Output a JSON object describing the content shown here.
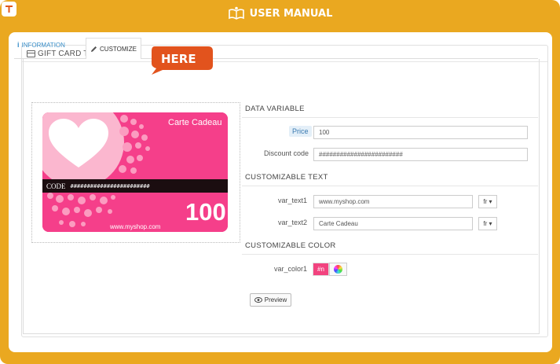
{
  "app": {
    "title": "USER MANUAL"
  },
  "panel": {
    "heading": "GIFT CARD TEMPLATE"
  },
  "tabs": [
    {
      "label": "INFORMATION",
      "active": false
    },
    {
      "label": "CUSTOMIZE",
      "active": true
    }
  ],
  "callout": {
    "text": "HERE"
  },
  "card": {
    "title": "Carte Cadeau",
    "code_label": "CODE",
    "code_value": "########################",
    "amount": "100",
    "site": "www.myshop.com"
  },
  "data_variable": {
    "heading": "DATA VARIABLE",
    "price_label": "Price",
    "price_value": "100",
    "discount_label": "Discount code",
    "discount_value": "########################"
  },
  "customizable_text": {
    "heading": "CUSTOMIZABLE TEXT",
    "fields": [
      {
        "label": "var_text1",
        "value": "www.myshop.com",
        "lang": "fr"
      },
      {
        "label": "var_text2",
        "value": "Carte Cadeau",
        "lang": "fr"
      }
    ]
  },
  "customizable_color": {
    "heading": "CUSTOMIZABLE COLOR",
    "label": "var_color1",
    "swatch_text": "#n",
    "color": "#f2437f"
  },
  "buttons": {
    "preview": "Preview"
  },
  "colors": {
    "frame": "#eaa820",
    "accent": "#f53f8a",
    "callout": "#e2531d"
  }
}
